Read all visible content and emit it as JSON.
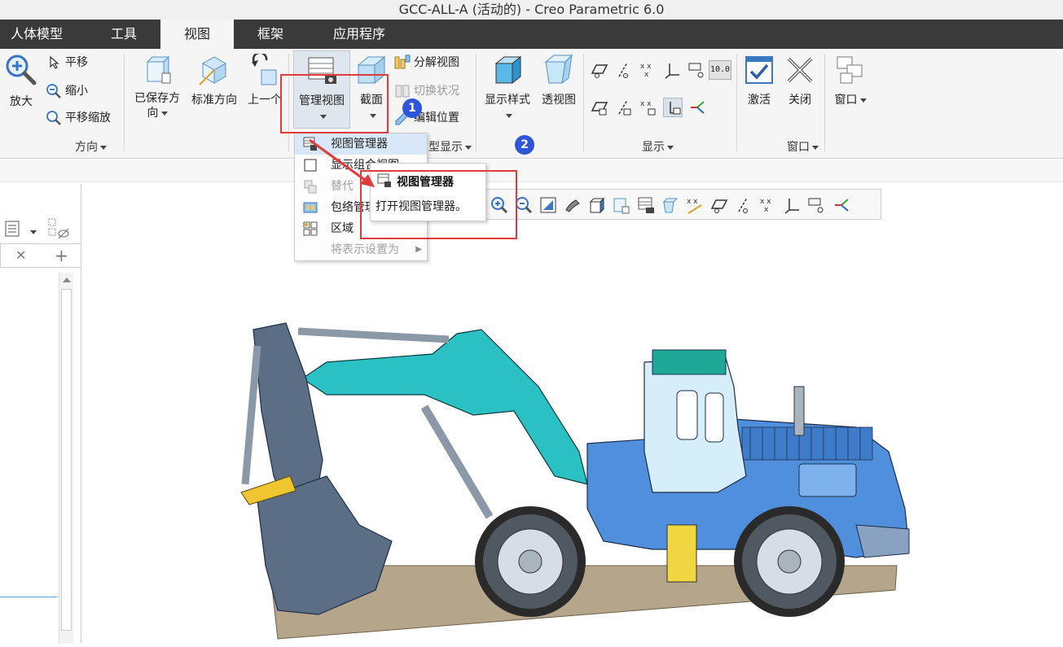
{
  "window": {
    "title": "GCC-ALL-A (活动的) - Creo Parametric 6.0"
  },
  "menu_tabs": [
    {
      "label": "人体模型"
    },
    {
      "label": "工具"
    },
    {
      "label": "视图"
    },
    {
      "label": "框架"
    },
    {
      "label": "应用程序"
    }
  ],
  "ribbon": {
    "zoom_in": "放大",
    "pan": "平移",
    "zoom_out": "缩小",
    "pan_zoom": "平移缩放",
    "saved_orientations": "已保存方向",
    "standard_orientation": "标准方向",
    "previous": "上一个",
    "manage_views": "管理视图",
    "section": "截面",
    "explode_view": "分解视图",
    "toggle_status": "切换状况",
    "edit_position": "编辑位置",
    "display_style": "显示样式",
    "perspective_view": "透视图",
    "activate": "激活",
    "close": "关闭",
    "window": "窗口",
    "groups": {
      "orientation": "方向",
      "model_display": "型显示",
      "show": "显示",
      "window": "窗口"
    },
    "label_box": "10.0"
  },
  "dropdown": {
    "items": [
      {
        "label": "视图管理器"
      },
      {
        "label": "显示组合视图"
      },
      {
        "label": "替代"
      },
      {
        "label": "包络管理器"
      },
      {
        "label": "区域"
      },
      {
        "label": "将表示设置为"
      }
    ]
  },
  "tooltip": {
    "title": "视图管理器",
    "description": "打开视图管理器。"
  },
  "badges": [
    "1",
    "2"
  ],
  "colors": {
    "menubar": "#3a3a3a",
    "ribbon": "#f5f5f5",
    "highlight_box": "#e23b3b",
    "badge": "#2f56d8",
    "excavator_arm": "#2bc0c4",
    "excavator_body": "#4f8fdb",
    "ground": "#b5a58a"
  }
}
